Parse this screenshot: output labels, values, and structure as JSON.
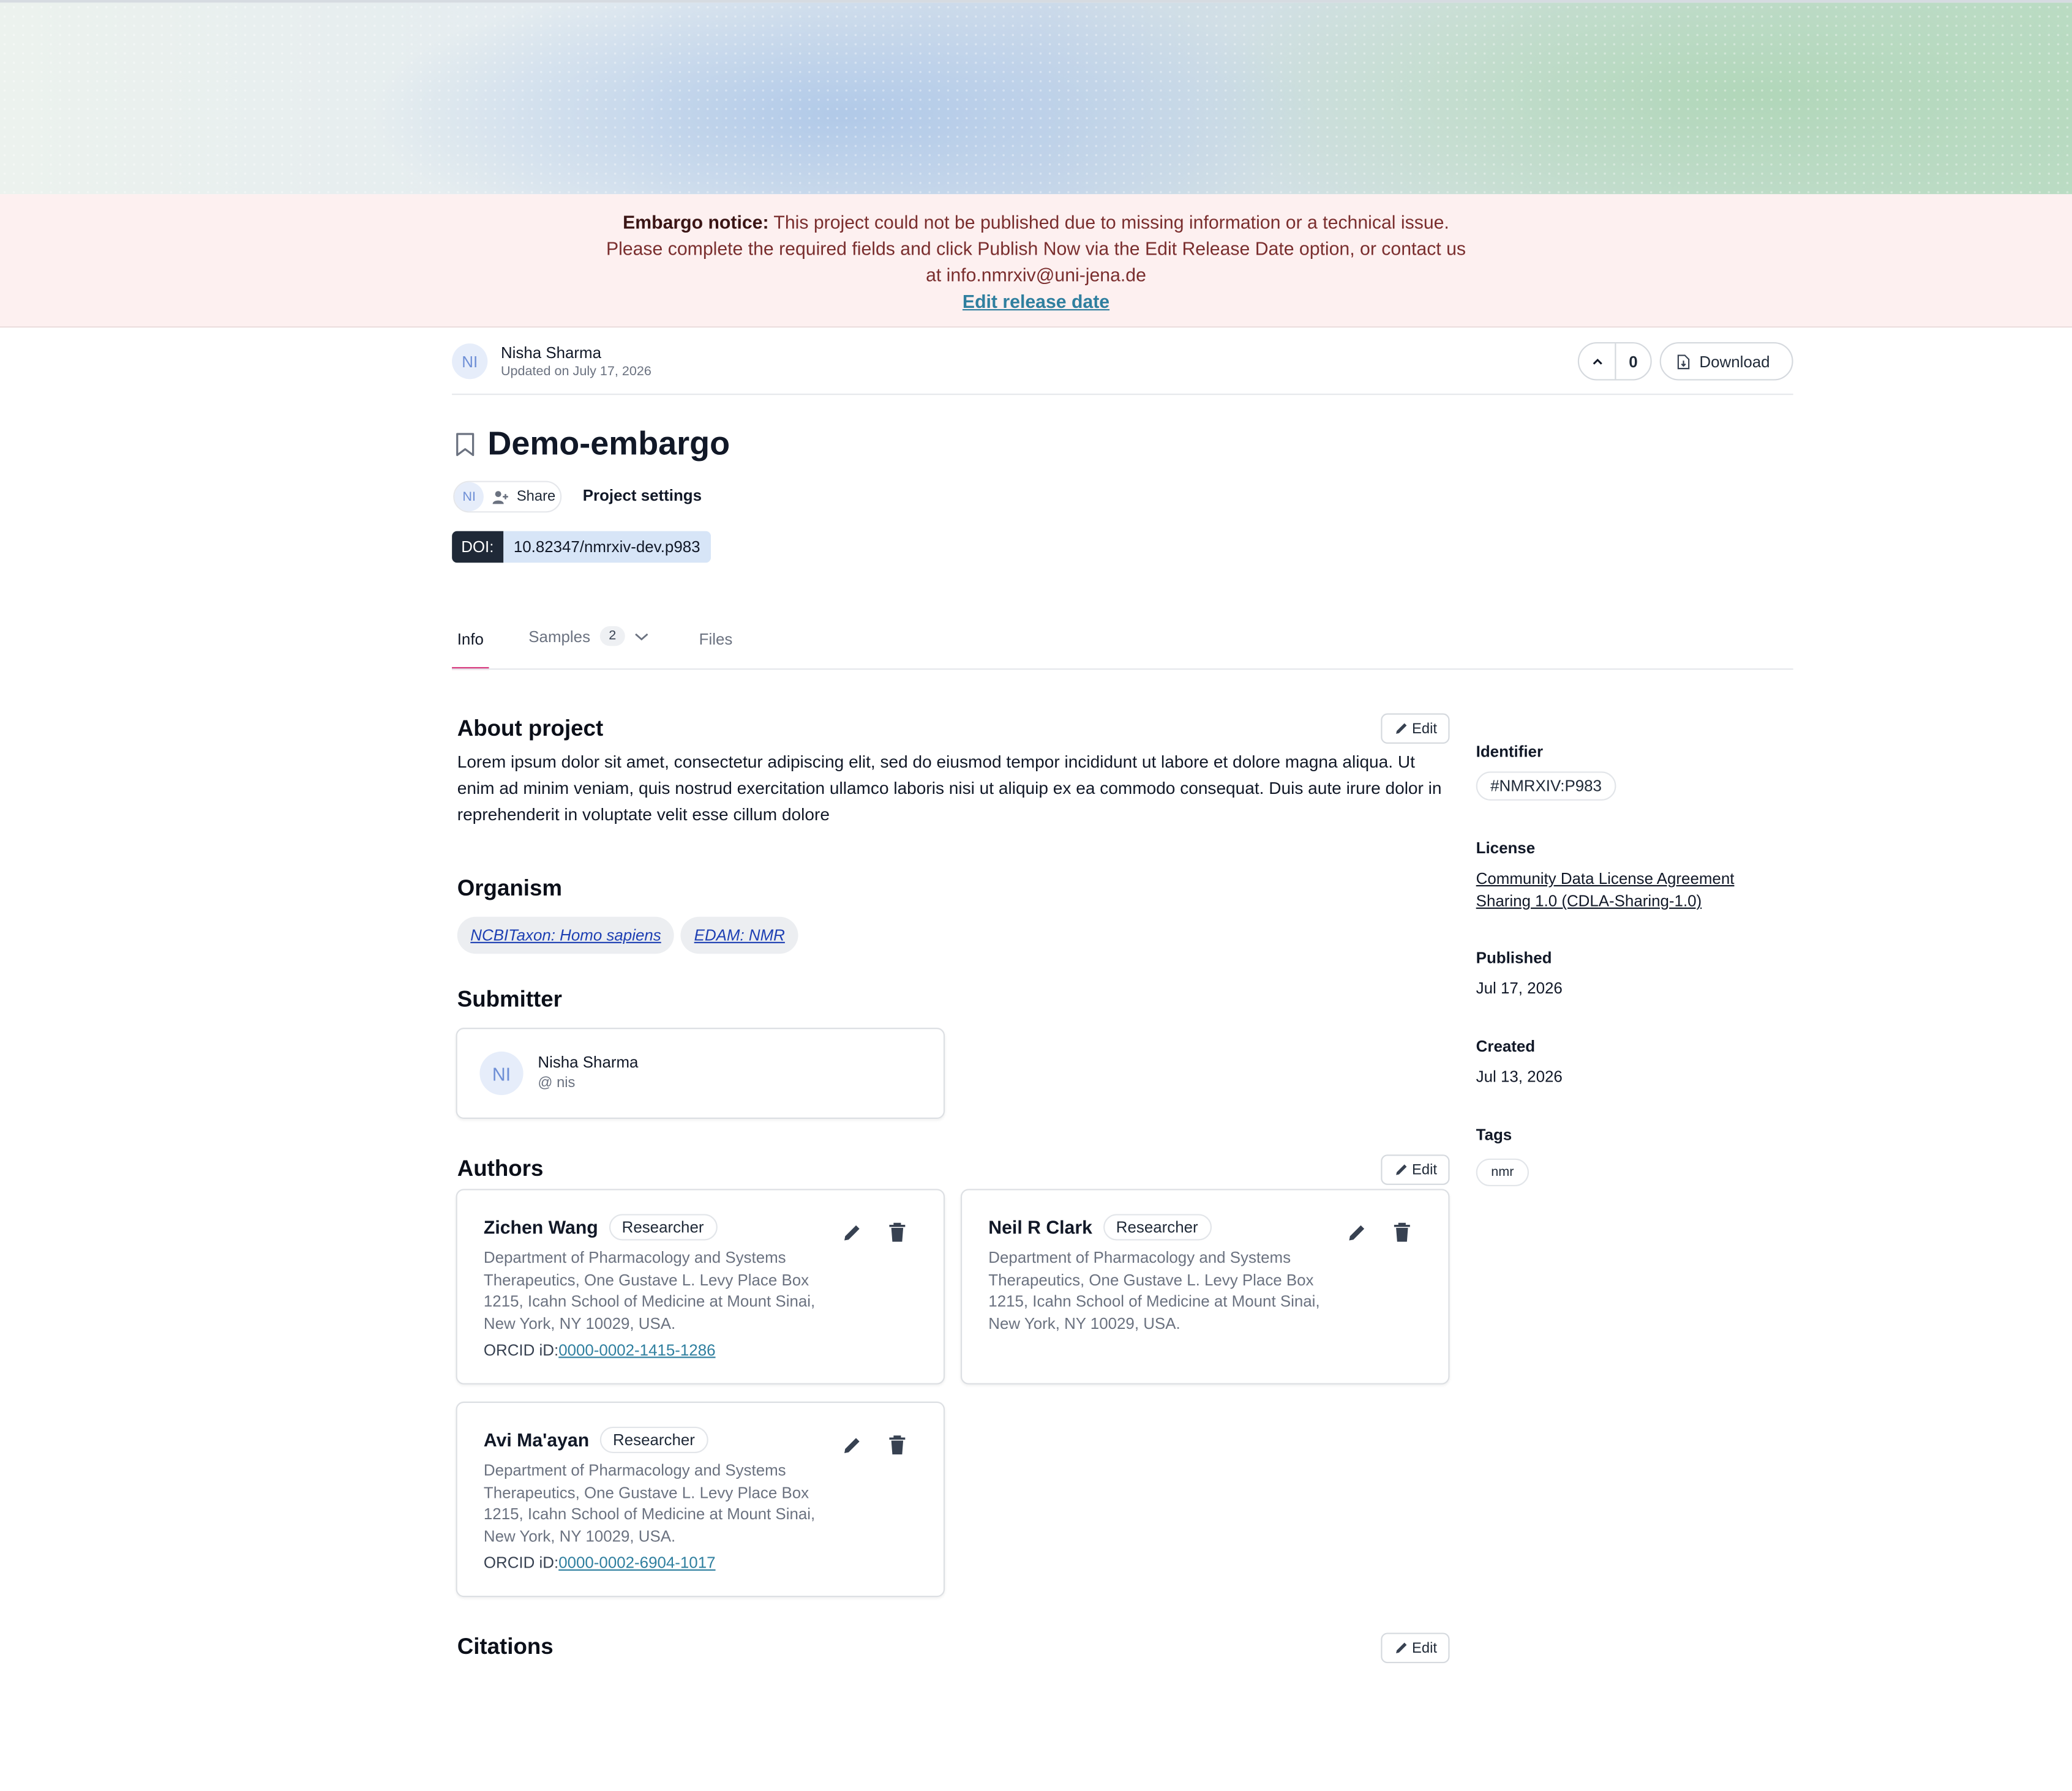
{
  "notice": {
    "label": "Embargo notice:",
    "line1": " This project could not be published due to missing information or a technical issue.",
    "line2": "Please complete the required fields and click Publish Now via the Edit Release Date option, or contact us",
    "line3": "at info.nmrxiv@uni-jena.de",
    "link": "Edit release date"
  },
  "owner": {
    "initials": "NI",
    "name": "Nisha Sharma",
    "updated": "Updated on July 17, 2026"
  },
  "actions": {
    "upvotes": "0",
    "download": "Download"
  },
  "project": {
    "title": "Demo-embargo",
    "share": "Share",
    "settings": "Project settings",
    "doi_label": "DOI:",
    "doi_value": "10.82347/nmrxiv-dev.p983"
  },
  "tabs": {
    "info": "Info",
    "samples": "Samples",
    "samples_count": "2",
    "files": "Files"
  },
  "about": {
    "heading": "About project",
    "edit": "Edit",
    "text": "Lorem ipsum dolor sit amet, consectetur adipiscing elit, sed do eiusmod tempor incididunt ut labore et dolore magna aliqua. Ut enim ad minim veniam, quis nostrud exercitation ullamco laboris nisi ut aliquip ex ea commodo consequat. Duis aute irure dolor in reprehenderit in voluptate velit esse cillum dolore"
  },
  "organism": {
    "heading": "Organism",
    "items": [
      "NCBITaxon: Homo sapiens",
      "EDAM: NMR"
    ]
  },
  "submitter": {
    "heading": "Submitter",
    "initials": "NI",
    "name": "Nisha Sharma",
    "handle": "@ nis"
  },
  "authors": {
    "heading": "Authors",
    "edit": "Edit",
    "orcid_label": "ORCID iD:",
    "list": [
      {
        "name": "Zichen Wang",
        "role": "Researcher",
        "affiliation": "Department of Pharmacology and Systems Therapeutics, One Gustave L. Levy Place Box 1215, Icahn School of Medicine at Mount Sinai, New York, NY 10029, USA.",
        "orcid": "0000-0002-1415-1286"
      },
      {
        "name": "Neil R Clark",
        "role": "Researcher",
        "affiliation": "Department of Pharmacology and Systems Therapeutics, One Gustave L. Levy Place Box 1215, Icahn School of Medicine at Mount Sinai, New York, NY 10029, USA.",
        "orcid": ""
      },
      {
        "name": "Avi Ma'ayan",
        "role": "Researcher",
        "affiliation": "Department of Pharmacology and Systems Therapeutics, One Gustave L. Levy Place Box 1215, Icahn School of Medicine at Mount Sinai, New York, NY 10029, USA.",
        "orcid": "0000-0002-6904-1017"
      }
    ]
  },
  "citations": {
    "heading": "Citations",
    "edit": "Edit"
  },
  "sidebar": {
    "identifier_label": "Identifier",
    "identifier_value": "#NMRXIV:P983",
    "license_label": "License",
    "license_value": "Community Data License Agreement Sharing 1.0 (CDLA-Sharing-1.0)",
    "published_label": "Published",
    "published_value": "Jul 17, 2026",
    "created_label": "Created",
    "created_value": "Jul 13, 2026",
    "tags_label": "Tags",
    "tags": [
      "nmr"
    ]
  }
}
